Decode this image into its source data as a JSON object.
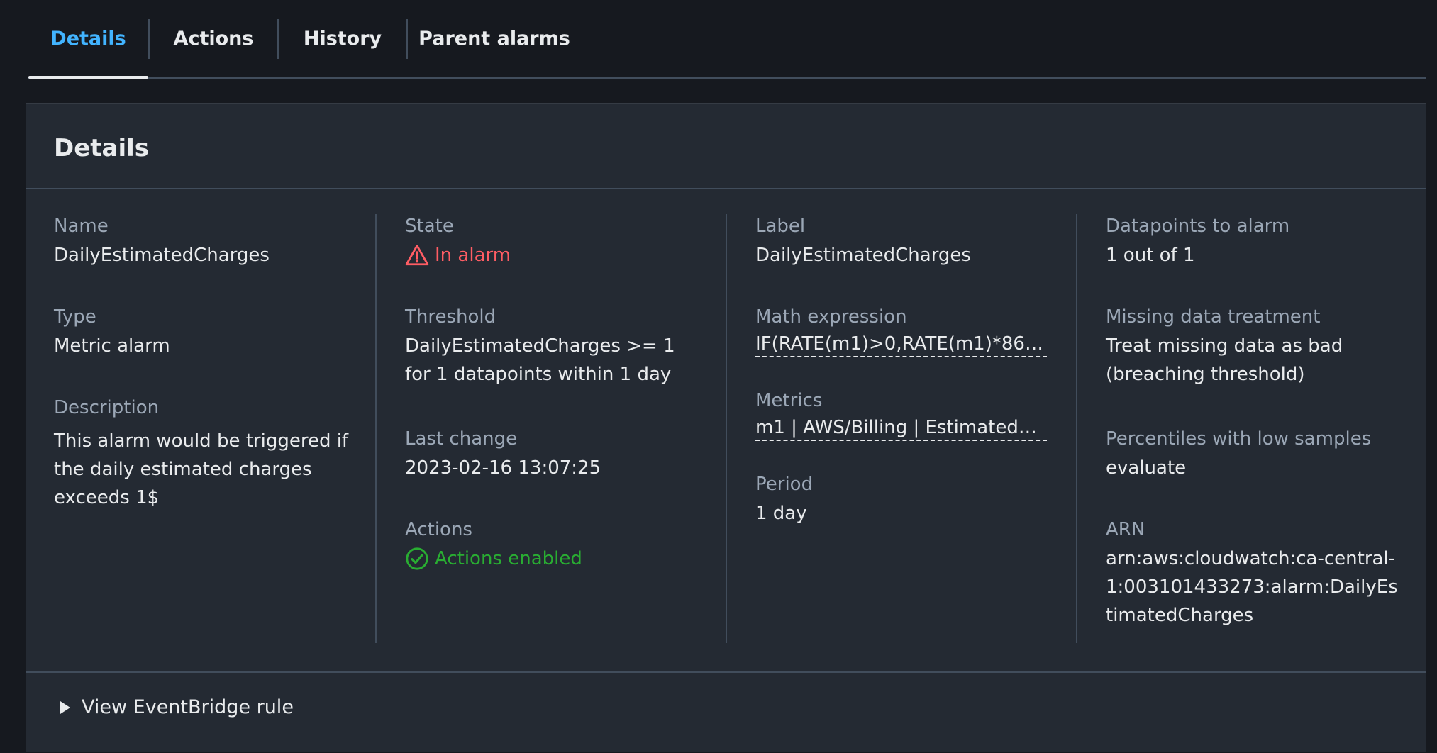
{
  "tabs": [
    {
      "label": "Details",
      "active": true
    },
    {
      "label": "Actions",
      "active": false
    },
    {
      "label": "History",
      "active": false
    },
    {
      "label": "Parent alarms",
      "active": false
    }
  ],
  "panel": {
    "title": "Details",
    "columns": [
      {
        "fields": [
          {
            "label": "Name",
            "value": "DailyEstimatedCharges"
          },
          {
            "label": "Type",
            "value": "Metric alarm"
          },
          {
            "label": "Description",
            "value": "This alarm would be triggered if the daily estimated charges exceeds 1$"
          }
        ]
      },
      {
        "fields": [
          {
            "label": "State",
            "value": "In alarm",
            "status": "alarm",
            "icon": "warning-icon",
            "color": "#ff5d64"
          },
          {
            "label": "Threshold",
            "value": "DailyEstimatedCharges >= 1 for 1 datapoints within 1 day"
          },
          {
            "label": "Last change",
            "value": "2023-02-16 13:07:25"
          },
          {
            "label": "Actions",
            "value": "Actions enabled",
            "status": "ok",
            "icon": "check-circle-icon",
            "color": "#29ad32"
          }
        ]
      },
      {
        "fields": [
          {
            "label": "Label",
            "value": "DailyEstimatedCharges"
          },
          {
            "label": "Math expression",
            "value": "IF(RATE(m1)>0,RATE(m1)*86400,0)"
          },
          {
            "label": "Metrics",
            "value": "m1 | AWS/Billing | EstimatedCharges"
          },
          {
            "label": "Period",
            "value": "1 day"
          }
        ]
      },
      {
        "fields": [
          {
            "label": "Datapoints to alarm",
            "value": "1 out of 1"
          },
          {
            "label": "Missing data treatment",
            "value": "Treat missing data as bad (breaching threshold)"
          },
          {
            "label": "Percentiles with low samples",
            "value": "evaluate"
          },
          {
            "label": "ARN",
            "value": "arn:aws:cloudwatch:ca-central-1:003101433273:alarm:DailyEstimatedCharges"
          }
        ]
      }
    ],
    "footer": {
      "expander_label": "View EventBridge rule",
      "icon": "caret-right-icon"
    }
  },
  "colors": {
    "background": "#16191f",
    "panel": "#242a33",
    "active_tab": "#42b4ff",
    "alarm": "#ff5d64",
    "ok": "#29ad32"
  }
}
